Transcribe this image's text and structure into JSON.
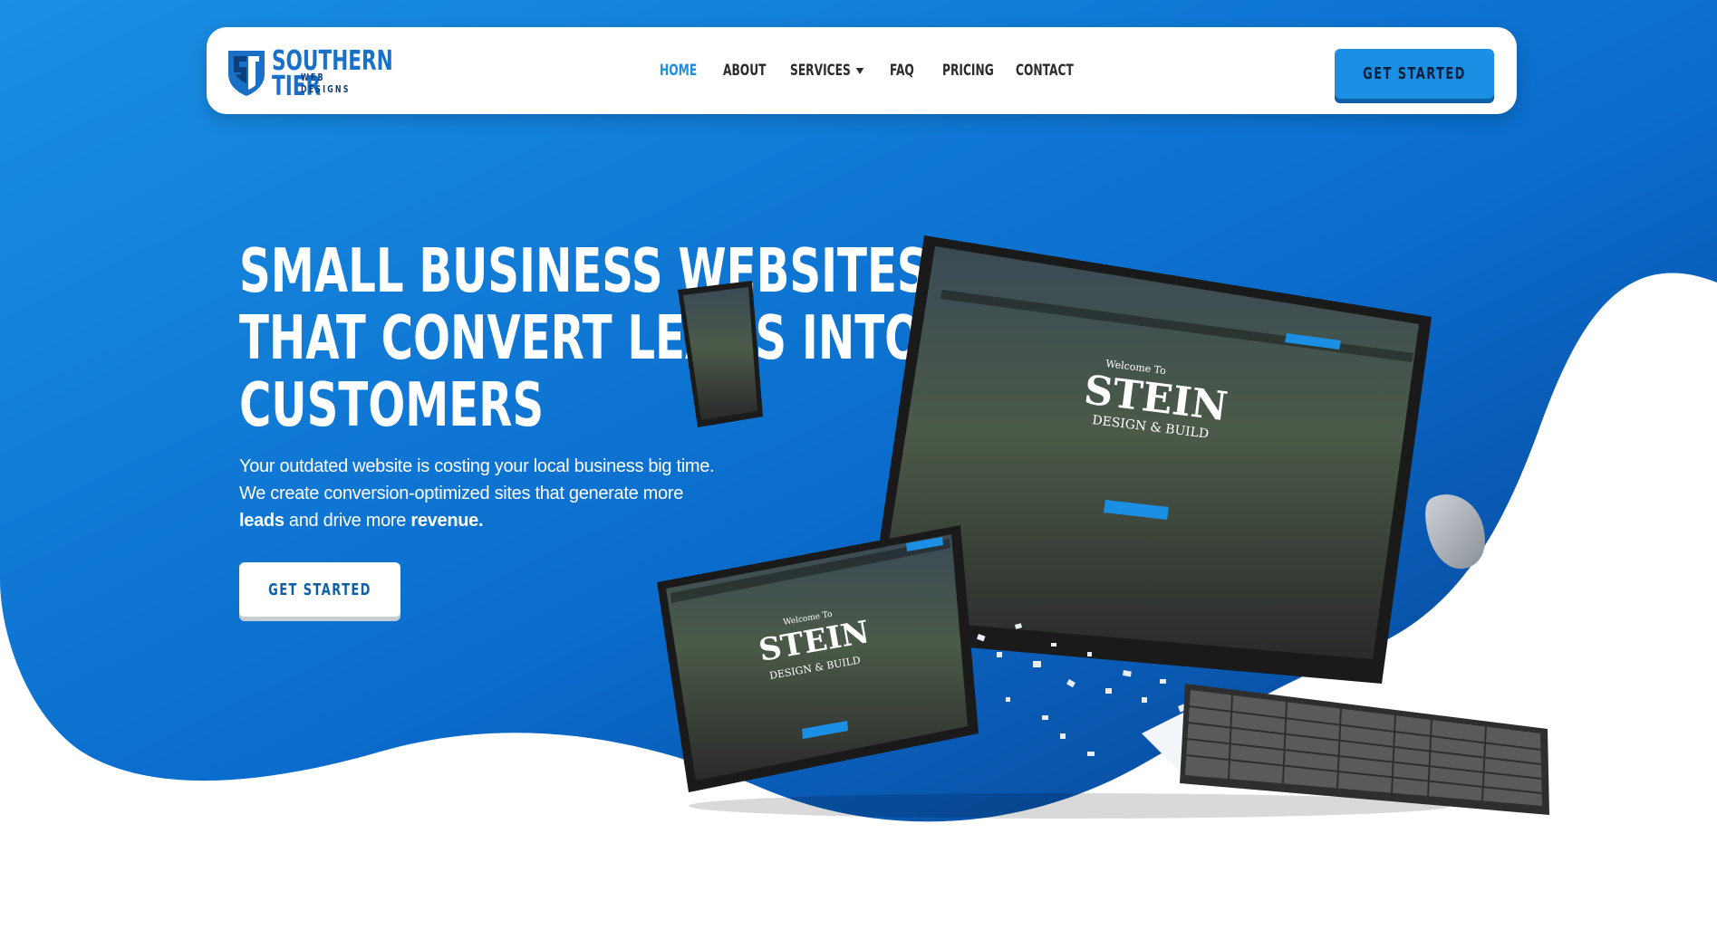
{
  "colors": {
    "brand_blue": "#1a8fe3",
    "deep_blue": "#0b4f9c",
    "nav_text": "#2b2b2b",
    "white": "#ffffff"
  },
  "brand": {
    "name_line1": "SOUTHERN",
    "name_line2": "TIER",
    "tagline_line1": "WEB",
    "tagline_line2": "DESIGNS",
    "logo_icon": "shield-monogram-icon"
  },
  "nav": {
    "items": [
      {
        "label": "HOME",
        "active": true
      },
      {
        "label": "ABOUT",
        "active": false
      },
      {
        "label": "SERVICES",
        "active": false,
        "has_dropdown": true
      },
      {
        "label": "FAQ",
        "active": false
      },
      {
        "label": "PRICING",
        "active": false
      },
      {
        "label": "CONTACT",
        "active": false
      }
    ],
    "cta_label": "GET STARTED"
  },
  "hero": {
    "headline_lines": [
      "SMALL BUSINESS WEBSITES",
      "THAT CONVERT LEADS INTO",
      "CUSTOMERS"
    ],
    "subtext_part1": "Your outdated website is costing your local business big time. We create conversion-optimized sites that generate more ",
    "subtext_bold1": "leads",
    "subtext_part2": " and drive more ",
    "subtext_bold2": "revenue.",
    "cta_label": "GET STARTED"
  },
  "mockup": {
    "welcome": "Welcome To",
    "brand_big": "STEIN",
    "brand_sub": "DESIGN & BUILD"
  }
}
